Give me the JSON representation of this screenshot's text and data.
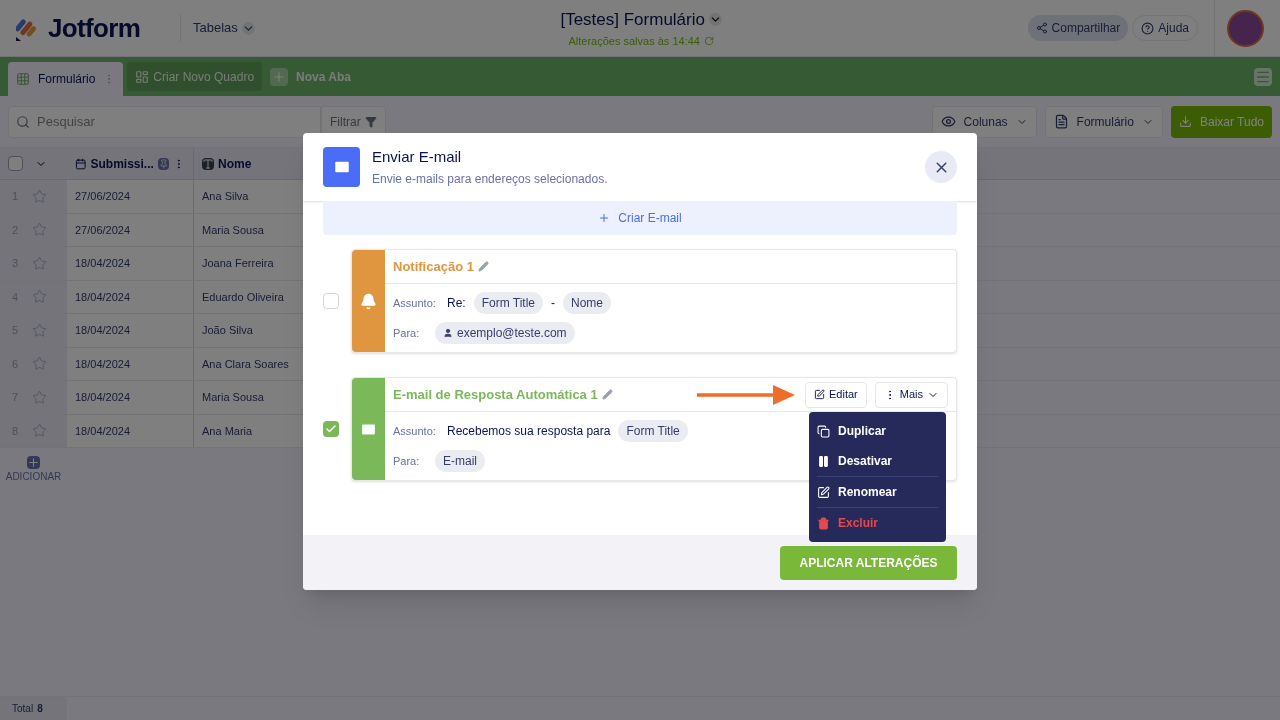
{
  "header": {
    "logo": "Jotform",
    "nav": "Tabelas",
    "title": "[Testes] Formulário",
    "saved": "Alterações salvas às 14:44",
    "share": "Compartilhar",
    "help": "Ajuda"
  },
  "tabs": [
    {
      "label": "Formulário",
      "selected": true
    }
  ],
  "tab_actions": [
    {
      "kind": "board",
      "label": "Criar Novo Quadro"
    },
    {
      "kind": "add",
      "label": "Nova Aba"
    }
  ],
  "toolbar": {
    "search": {
      "placeholder": "Pesquisar"
    },
    "filter": "Filtrar",
    "columns": "Colunas",
    "form": "Formulário",
    "download": "Baixar Tudo"
  },
  "table": {
    "columns": [
      {
        "kind": "date",
        "label": "Submissi..."
      },
      {
        "kind": "text",
        "label": "Nome"
      }
    ],
    "rows": [
      {
        "number": "1",
        "starred": false,
        "date": "27/06/2024",
        "name": "Ana Silva"
      },
      {
        "number": "2",
        "starred": false,
        "date": "27/06/2024",
        "name": "Maria Sousa"
      },
      {
        "number": "3",
        "starred": false,
        "date": "18/04/2024",
        "name": "Joana Ferreira"
      },
      {
        "number": "4",
        "starred": false,
        "date": "18/04/2024",
        "name": "Eduardo Oliveira"
      },
      {
        "number": "5",
        "starred": false,
        "date": "18/04/2024",
        "name": "João Silva"
      },
      {
        "number": "6",
        "starred": false,
        "date": "18/04/2024",
        "name": "Ana Clara Soares"
      },
      {
        "number": "7",
        "starred": false,
        "date": "18/04/2024",
        "name": "Maria Sousa"
      },
      {
        "number": "8",
        "starred": false,
        "date": "18/04/2024",
        "name": "Ana Maria"
      }
    ],
    "add_label": "ADICIONAR",
    "all_selected": false
  },
  "footer": {
    "total_label": "Total",
    "total": "8"
  },
  "modal": {
    "title": "Enviar E-mail",
    "subtitle": "Envie e-mails para endereços selecionados.",
    "create": "Criar E-mail",
    "emails": [
      {
        "kind": "notification",
        "checked": false,
        "title": "Notificação 1",
        "subject_label": "Assunto:",
        "subject": [
          {
            "kind": "text",
            "text": "Re:"
          },
          {
            "kind": "tag",
            "text": "Form Title"
          },
          {
            "kind": "text",
            "text": "-"
          },
          {
            "kind": "tag",
            "text": "Nome"
          }
        ],
        "to_label": "Para:",
        "to": [
          {
            "kind": "user",
            "text": "exemplo@teste.com"
          }
        ]
      },
      {
        "kind": "autoresponder",
        "checked": true,
        "title": "E-mail de Resposta Automática 1",
        "subject_label": "Assunto:",
        "subject": [
          {
            "kind": "text",
            "text": "Recebemos sua resposta para"
          },
          {
            "kind": "tag",
            "text": "Form Title"
          }
        ],
        "to_label": "Para:",
        "to": [
          {
            "kind": "tag",
            "text": "E-mail"
          }
        ],
        "edit": "Editar",
        "more": "Mais",
        "menu": [
          {
            "kind": "duplicate",
            "label": "Duplicar"
          },
          {
            "kind": "disable",
            "label": "Desativar"
          },
          {
            "kind": "rename",
            "label": "Renomear"
          },
          {
            "kind": "delete",
            "label": "Excluir"
          }
        ]
      }
    ],
    "apply": "APLICAR ALTERAÇÕES"
  }
}
